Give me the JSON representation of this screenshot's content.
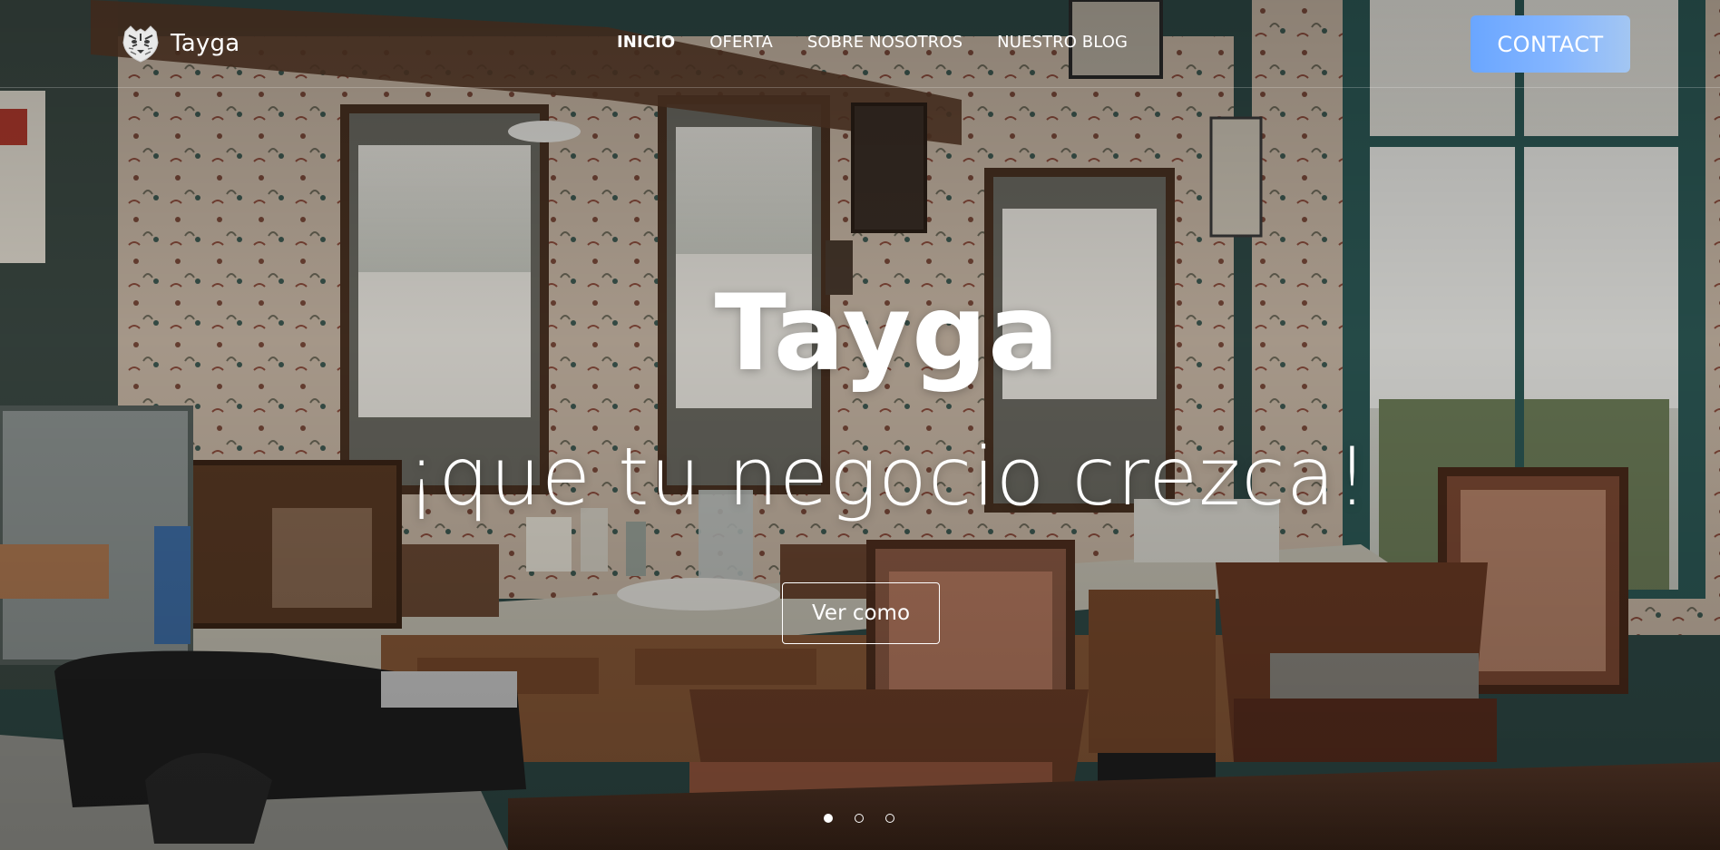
{
  "brand": {
    "name": "Tayga",
    "logo_icon": "tiger-head-icon"
  },
  "nav": {
    "items": [
      {
        "label": "INICIO",
        "active": true
      },
      {
        "label": "OFERTA",
        "active": false
      },
      {
        "label": "SOBRE NOSOTROS",
        "active": false
      },
      {
        "label": "NUESTRO BLOG",
        "active": false
      }
    ]
  },
  "contact": {
    "label": "CONTACT",
    "color_start": "#6aa6ff",
    "color_end": "#a3c6f2"
  },
  "hero": {
    "title": "Tayga",
    "subtitle": "¡que tu negocio crezca!",
    "cta_label": "Ver como",
    "background": "barber-shop-photo"
  },
  "carousel": {
    "slide_count": 3,
    "active_index": 0
  }
}
